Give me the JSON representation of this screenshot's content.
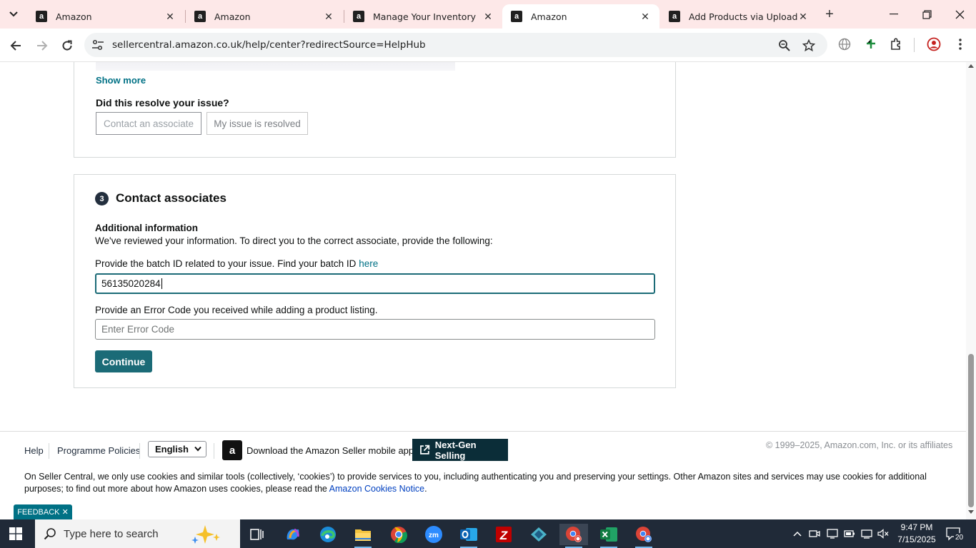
{
  "browser": {
    "tabs": [
      {
        "title": "Amazon",
        "active": false
      },
      {
        "title": "Amazon",
        "active": false
      },
      {
        "title": "Manage Your Inventory",
        "active": false
      },
      {
        "title": "Amazon",
        "active": true
      },
      {
        "title": "Add Products via Upload: Cl",
        "active": false
      }
    ],
    "url": "sellercentral.amazon.co.uk/help/center?redirectSource=HelpHub"
  },
  "resolve_section": {
    "show_more": "Show more",
    "question": "Did this resolve your issue?",
    "contact_button": "Contact an associate",
    "resolved_button": "My issue is resolved"
  },
  "contact_section": {
    "step_number": "3",
    "title": "Contact associates",
    "info_heading": "Additional information",
    "info_text": "We've reviewed your information. To direct you to the correct associate, provide the following:",
    "batch_label": "Provide the batch ID related to your issue. Find your batch ID",
    "batch_link": "here",
    "batch_value": "56135020284",
    "error_label": "Provide an Error Code you received while adding a product listing.",
    "error_placeholder": "Enter Error Code",
    "continue_label": "Continue"
  },
  "footer": {
    "help": "Help",
    "policies": "Programme Policies",
    "language": "English",
    "app_download": "Download the Amazon Seller mobile app",
    "next_gen": "Next-Gen Selling",
    "copyright": "© 1999–2025, Amazon.com, Inc. or its affiliates",
    "cookie_text": "On Seller Central, we only use cookies and similar tools (collectively, ‘cookies’) to provide services to you, including authenticating you and preserving your settings. Other Amazon sites and services may use cookies for additional purposes; to find out more about how Amazon uses cookies, please read the",
    "cookie_link": "Amazon Cookies Notice",
    "cookie_end": ".",
    "feedback": "FEEDBACK"
  },
  "taskbar": {
    "search_placeholder": "Type here to search",
    "time": "9:47 PM",
    "date": "7/15/2025",
    "notifications": "20"
  },
  "colors": {
    "accent_teal": "#1b6b77",
    "link": "#007185",
    "tab_strip": "#fde8e8",
    "taskbar": "#202a38"
  }
}
